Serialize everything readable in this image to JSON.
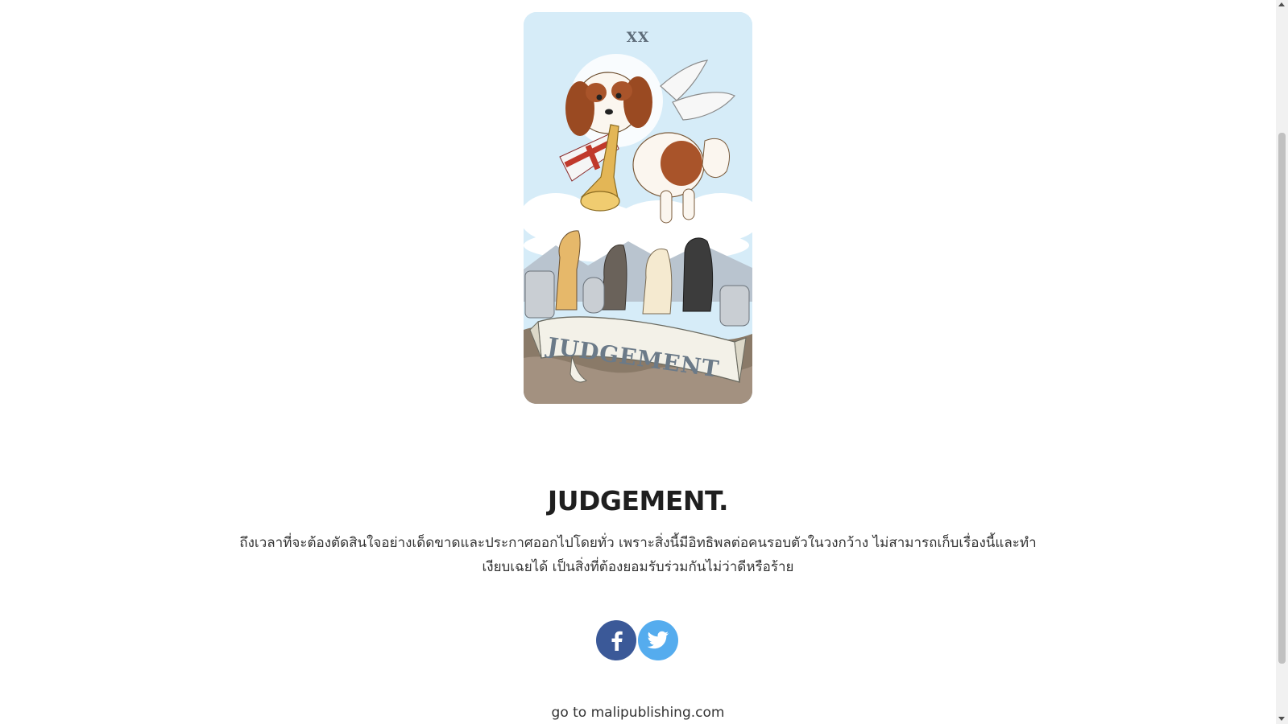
{
  "card": {
    "numeral": "XX",
    "banner_text": "JUDGEMENT",
    "colors": {
      "sky": "#d6ecf8",
      "banner": "#f3f1e8",
      "ground": "#8a7a68"
    }
  },
  "content": {
    "title": "JUDGEMENT.",
    "description": "ถึงเวลาที่จะต้องตัดสินใจอย่างเด็ดขาดและประกาศออกไปโดยทั่ว เพราะสิ่งนี้มีอิทธิพลต่อคนรอบตัวในวงกว้าง ไม่สามารถเก็บเรื่องนี้และทำเงียบเฉยได้ เป็นสิ่งที่ต้องยอมรับร่วมกันไม่ว่าดีหรือร้าย"
  },
  "social": {
    "facebook_icon": "facebook-icon",
    "twitter_icon": "twitter-icon",
    "facebook_color": "#3b5998",
    "twitter_color": "#55acee"
  },
  "footer": {
    "link_text": "go to malipublishing.com"
  }
}
